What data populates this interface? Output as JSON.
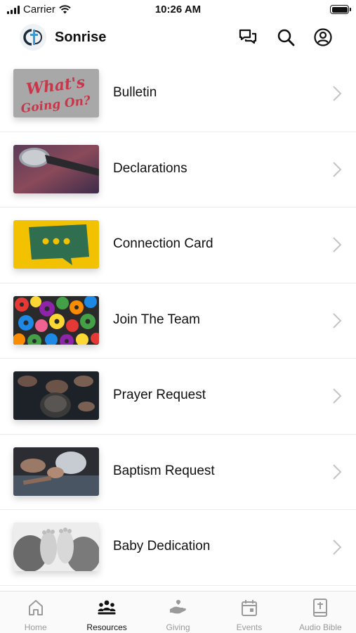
{
  "status_bar": {
    "carrier": "Carrier",
    "time": "10:26 AM"
  },
  "header": {
    "title": "Sonrise",
    "icons": [
      "chat-bubbles-icon",
      "search-icon",
      "account-icon"
    ]
  },
  "resources": [
    {
      "label": "Bulletin",
      "thumb_text": [
        "What's",
        "Going On?"
      ]
    },
    {
      "label": "Declarations"
    },
    {
      "label": "Connection Card"
    },
    {
      "label": "Join The Team"
    },
    {
      "label": "Prayer Request"
    },
    {
      "label": "Baptism Request"
    },
    {
      "label": "Baby Dedication"
    }
  ],
  "tab_bar": {
    "tabs": [
      {
        "label": "Home",
        "icon": "home-icon",
        "active": false
      },
      {
        "label": "Resources",
        "icon": "people-group-icon",
        "active": true
      },
      {
        "label": "Giving",
        "icon": "giving-hand-icon",
        "active": false
      },
      {
        "label": "Events",
        "icon": "calendar-icon",
        "active": false
      },
      {
        "label": "Audio Bible",
        "icon": "bible-icon",
        "active": false
      }
    ]
  },
  "colors": {
    "accent": "#111111",
    "inactive_tab": "#9a9a9a",
    "divider": "#ececec",
    "connection_card_bg": "#f2c200",
    "bubble_green": "#2f6e4f"
  }
}
